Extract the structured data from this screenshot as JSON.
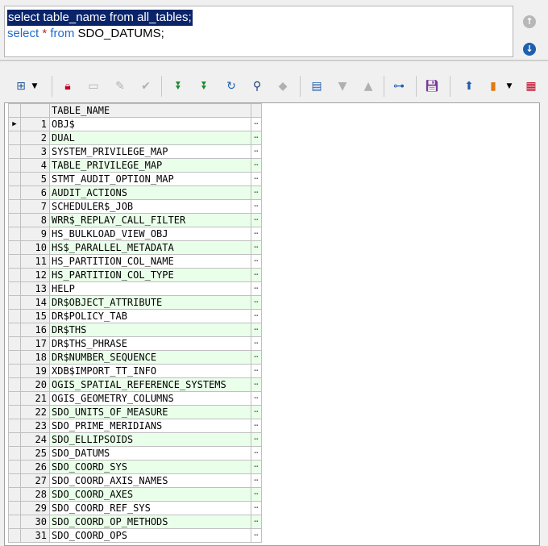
{
  "editor": {
    "line1": "select table_name from all_tables;",
    "line2_kw1": "select",
    "line2_star": "*",
    "line2_kw2": "from",
    "line2_rest": "SDO_DATUMS;"
  },
  "scroll_icons": {
    "up": "up-arrow-icon",
    "down": "down-arrow-icon"
  },
  "toolbar": {
    "icons": [
      "grid-select-icon",
      "chevron-down-icon",
      "lock-icon",
      "add-record-icon",
      "delete-record-icon",
      "post-check-icon",
      "fetch-next-icon",
      "fetch-last-icon",
      "refresh-icon",
      "find-icon",
      "clear-icon",
      "query-by-example-icon",
      "sort-ascending-icon",
      "sort-descending-icon",
      "tree-view-icon",
      "save-icon",
      "export-icon",
      "chart-icon",
      "chevron-down-icon",
      "table-view-icon"
    ]
  },
  "colors": {
    "selection": "#0a246a",
    "alt_row": "#eaffea",
    "keyword": "#1e6cc8"
  },
  "grid": {
    "header": "TABLE_NAME",
    "rows": [
      {
        "n": "1",
        "name": "OBJ$"
      },
      {
        "n": "2",
        "name": "DUAL"
      },
      {
        "n": "3",
        "name": "SYSTEM_PRIVILEGE_MAP"
      },
      {
        "n": "4",
        "name": "TABLE_PRIVILEGE_MAP"
      },
      {
        "n": "5",
        "name": "STMT_AUDIT_OPTION_MAP"
      },
      {
        "n": "6",
        "name": "AUDIT_ACTIONS"
      },
      {
        "n": "7",
        "name": "SCHEDULER$_JOB"
      },
      {
        "n": "8",
        "name": "WRR$_REPLAY_CALL_FILTER"
      },
      {
        "n": "9",
        "name": "HS_BULKLOAD_VIEW_OBJ"
      },
      {
        "n": "10",
        "name": "HS$_PARALLEL_METADATA"
      },
      {
        "n": "11",
        "name": "HS_PARTITION_COL_NAME"
      },
      {
        "n": "12",
        "name": "HS_PARTITION_COL_TYPE"
      },
      {
        "n": "13",
        "name": "HELP"
      },
      {
        "n": "14",
        "name": "DR$OBJECT_ATTRIBUTE"
      },
      {
        "n": "15",
        "name": "DR$POLICY_TAB"
      },
      {
        "n": "16",
        "name": "DR$THS"
      },
      {
        "n": "17",
        "name": "DR$THS_PHRASE"
      },
      {
        "n": "18",
        "name": "DR$NUMBER_SEQUENCE"
      },
      {
        "n": "19",
        "name": "XDB$IMPORT_TT_INFO"
      },
      {
        "n": "20",
        "name": "OGIS_SPATIAL_REFERENCE_SYSTEMS"
      },
      {
        "n": "21",
        "name": "OGIS_GEOMETRY_COLUMNS"
      },
      {
        "n": "22",
        "name": "SDO_UNITS_OF_MEASURE"
      },
      {
        "n": "23",
        "name": "SDO_PRIME_MERIDIANS"
      },
      {
        "n": "24",
        "name": "SDO_ELLIPSOIDS"
      },
      {
        "n": "25",
        "name": "SDO_DATUMS"
      },
      {
        "n": "26",
        "name": "SDO_COORD_SYS"
      },
      {
        "n": "27",
        "name": "SDO_COORD_AXIS_NAMES"
      },
      {
        "n": "28",
        "name": "SDO_COORD_AXES"
      },
      {
        "n": "29",
        "name": "SDO_COORD_REF_SYS"
      },
      {
        "n": "30",
        "name": "SDO_COORD_OP_METHODS"
      },
      {
        "n": "31",
        "name": "SDO_COORD_OPS"
      }
    ]
  }
}
